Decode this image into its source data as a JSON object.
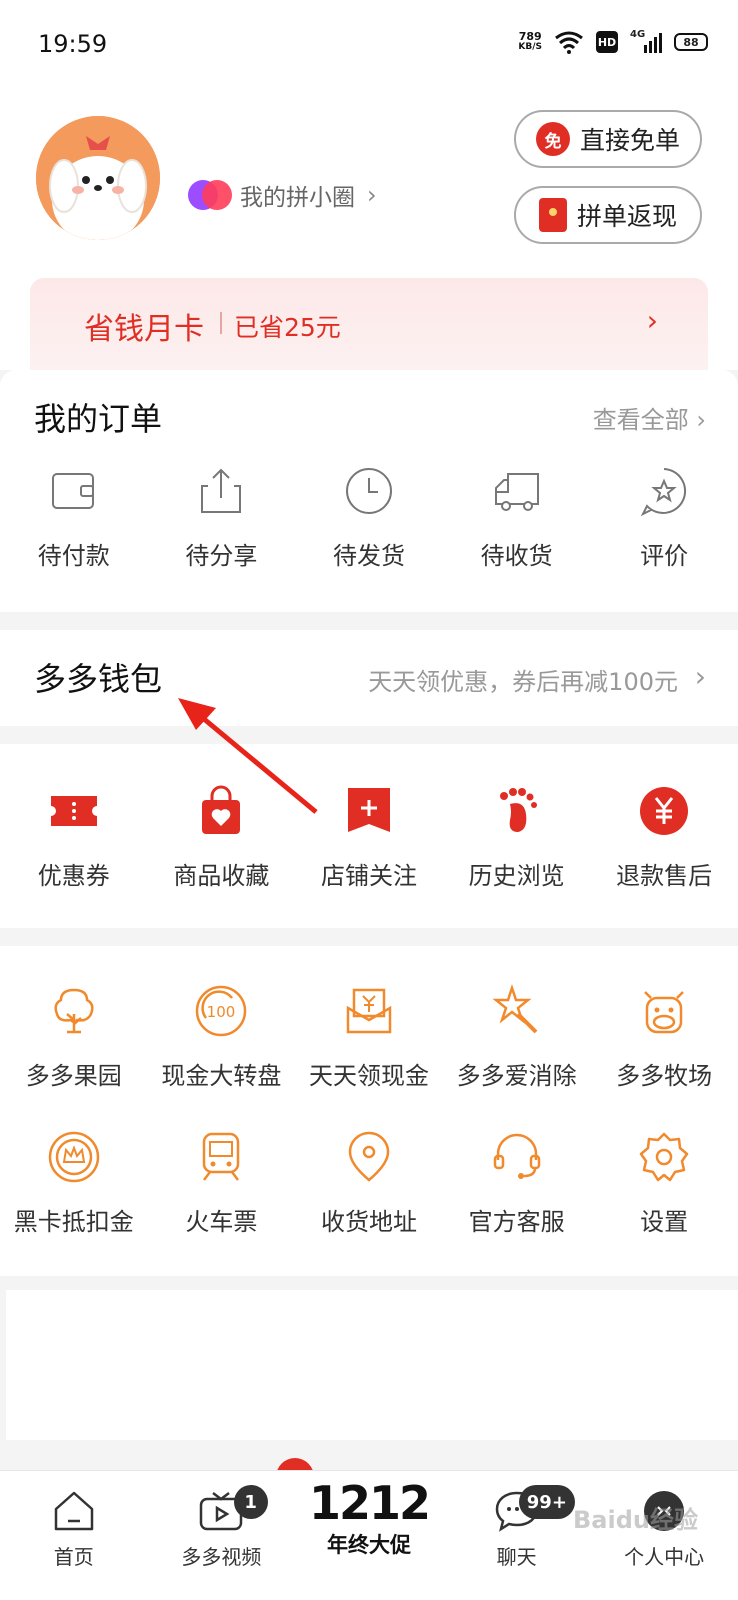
{
  "status_bar": {
    "time": "19:59",
    "net_speed_value": "789",
    "net_speed_unit": "KB/S",
    "hd": "HD",
    "network": "4G",
    "battery": "88"
  },
  "profile": {
    "pin_circle_label": "我的拼小圈",
    "pin_circle_arrow": "›",
    "free_order_icon": "免",
    "free_order_label": "直接免单",
    "cashback_label": "拼单返现"
  },
  "month_card": {
    "title": "省钱月卡",
    "saved": "已省25元",
    "arrow": "›"
  },
  "orders": {
    "title": "我的订单",
    "view_all": "查看全部 ›",
    "items": [
      {
        "label": "待付款",
        "icon": "wallet-icon"
      },
      {
        "label": "待分享",
        "icon": "share-icon"
      },
      {
        "label": "待发货",
        "icon": "clock-icon"
      },
      {
        "label": "待收货",
        "icon": "truck-icon"
      },
      {
        "label": "评价",
        "icon": "star-icon"
      }
    ]
  },
  "wallet": {
    "title": "多多钱包",
    "promo": "天天领优惠，券后再减100元",
    "arrow": "›"
  },
  "quick_tools": [
    {
      "label": "优惠券",
      "icon": "coupon-icon"
    },
    {
      "label": "商品收藏",
      "icon": "favorite-bag-icon"
    },
    {
      "label": "店铺关注",
      "icon": "store-follow-icon"
    },
    {
      "label": "历史浏览",
      "icon": "footprint-icon"
    },
    {
      "label": "退款售后",
      "icon": "refund-icon"
    }
  ],
  "services_row1": [
    {
      "label": "多多果园",
      "icon": "tree-icon"
    },
    {
      "label": "现金大转盘",
      "icon": "wheel-icon"
    },
    {
      "label": "天天领现金",
      "icon": "cash-envelope-icon"
    },
    {
      "label": "多多爱消除",
      "icon": "star-wand-icon"
    },
    {
      "label": "多多牧场",
      "icon": "cow-icon"
    }
  ],
  "services_row2": [
    {
      "label": "黑卡抵扣金",
      "icon": "crown-coin-icon"
    },
    {
      "label": "火车票",
      "icon": "train-icon"
    },
    {
      "label": "收货地址",
      "icon": "location-icon"
    },
    {
      "label": "官方客服",
      "icon": "headset-icon"
    },
    {
      "label": "设置",
      "icon": "gear-icon"
    }
  ],
  "tabbar": {
    "tabs": [
      {
        "label": "首页",
        "icon": "home-icon"
      },
      {
        "label": "多多视频",
        "icon": "video-icon",
        "badge": "1"
      },
      {
        "label": "年终大促",
        "promo": "1212"
      },
      {
        "label": "聊天",
        "icon": "chat-icon",
        "badge": "99+"
      },
      {
        "label": "个人中心",
        "icon": "profile-icon"
      }
    ]
  },
  "watermark": "Baidu经验",
  "colors": {
    "brand_red": "#e02e24",
    "service_orange": "#f08a2c",
    "month_card_bg": "#fde8e8"
  }
}
